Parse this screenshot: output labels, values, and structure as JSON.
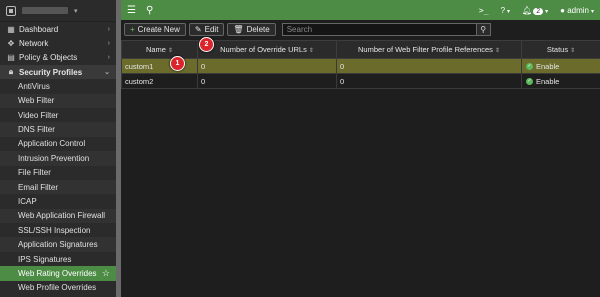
{
  "sidebar": {
    "top_items": [
      {
        "label": "Dashboard",
        "icon": "dashboard-icon"
      },
      {
        "label": "Network",
        "icon": "network-icon"
      },
      {
        "label": "Policy & Objects",
        "icon": "policy-icon"
      }
    ],
    "section": {
      "label": "Security Profiles",
      "icon": "lock-icon"
    },
    "sub_items": [
      "AntiVirus",
      "Web Filter",
      "Video Filter",
      "DNS Filter",
      "Application Control",
      "Intrusion Prevention",
      "File Filter",
      "Email Filter",
      "ICAP",
      "Web Application Firewall",
      "SSL/SSH Inspection",
      "Application Signatures",
      "IPS Signatures",
      "Web Rating Overrides",
      "Web Profile Overrides"
    ],
    "active_item": "Web Rating Overrides"
  },
  "topbar": {
    "notification_count": "2",
    "user": "admin"
  },
  "toolbar": {
    "create_label": "Create New",
    "edit_label": "Edit",
    "delete_label": "Delete",
    "search_placeholder": "Search"
  },
  "table": {
    "columns": [
      "Name",
      "Number of Override URLs",
      "Number of Web Filter Profile References",
      "Status"
    ],
    "rows": [
      {
        "name": "custom1",
        "urls": "0",
        "refs": "0",
        "status": "Enable",
        "selected": true
      },
      {
        "name": "custom2",
        "urls": "0",
        "refs": "0",
        "status": "Enable",
        "selected": false
      }
    ]
  },
  "callouts": {
    "first": "1",
    "second": "2"
  },
  "colors": {
    "accent": "#4c8c45",
    "selected_row": "#6b6b2b",
    "callout": "#d9252b"
  }
}
